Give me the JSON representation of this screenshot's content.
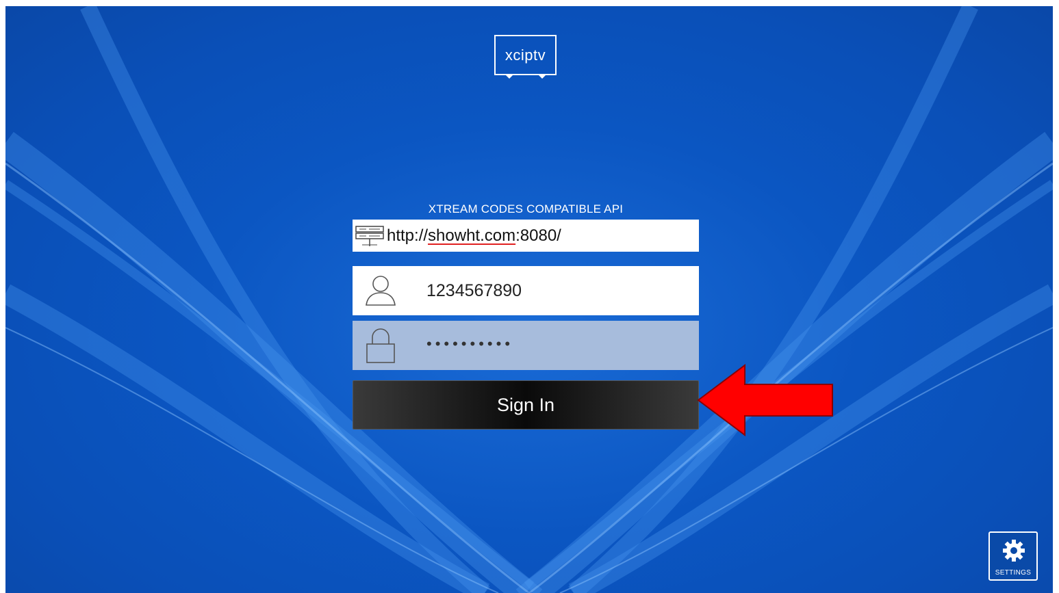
{
  "app": {
    "logo_text": "xciptv"
  },
  "login": {
    "api_title": "XTREAM CODES COMPATIBLE API",
    "server_url_prefix": "http://",
    "server_url_domain": "showht.com",
    "server_url_suffix": ":8080/",
    "username_value": "1234567890",
    "password_masked": "••••••••••",
    "sign_in_label": "Sign In"
  },
  "settings": {
    "label": "SETTINGS"
  },
  "annotation": {
    "arrow_color": "#ff0000"
  },
  "theme": {
    "background": "#0b56c2",
    "password_field_bg": "#a7bcdc"
  },
  "icons": {
    "server": "server-icon",
    "user": "user-icon",
    "lock": "lock-icon",
    "gear": "gear-icon"
  }
}
